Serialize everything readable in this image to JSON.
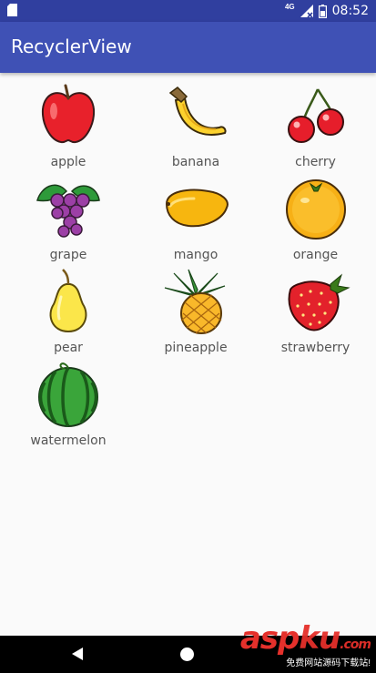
{
  "status_bar": {
    "network": "4G",
    "time": "08:52",
    "icons": [
      "sd-card-icon",
      "signal-icon",
      "battery-icon"
    ]
  },
  "app_bar": {
    "title": "RecyclerView",
    "background": "#3f51b5",
    "status_background": "#303f9f"
  },
  "fruits": [
    {
      "name": "apple",
      "icon": "apple-icon"
    },
    {
      "name": "banana",
      "icon": "banana-icon"
    },
    {
      "name": "cherry",
      "icon": "cherry-icon"
    },
    {
      "name": "grape",
      "icon": "grape-icon"
    },
    {
      "name": "mango",
      "icon": "mango-icon"
    },
    {
      "name": "orange",
      "icon": "orange-icon"
    },
    {
      "name": "pear",
      "icon": "pear-icon"
    },
    {
      "name": "pineapple",
      "icon": "pineapple-icon"
    },
    {
      "name": "strawberry",
      "icon": "strawberry-icon"
    },
    {
      "name": "watermelon",
      "icon": "watermelon-icon"
    }
  ],
  "nav_bar": {
    "icons": [
      "back-icon",
      "home-icon"
    ]
  },
  "watermark": {
    "main_accent": "asp",
    "main_rest": "ku",
    "suffix": ".com",
    "sub": "免费网站源码下载站!"
  }
}
